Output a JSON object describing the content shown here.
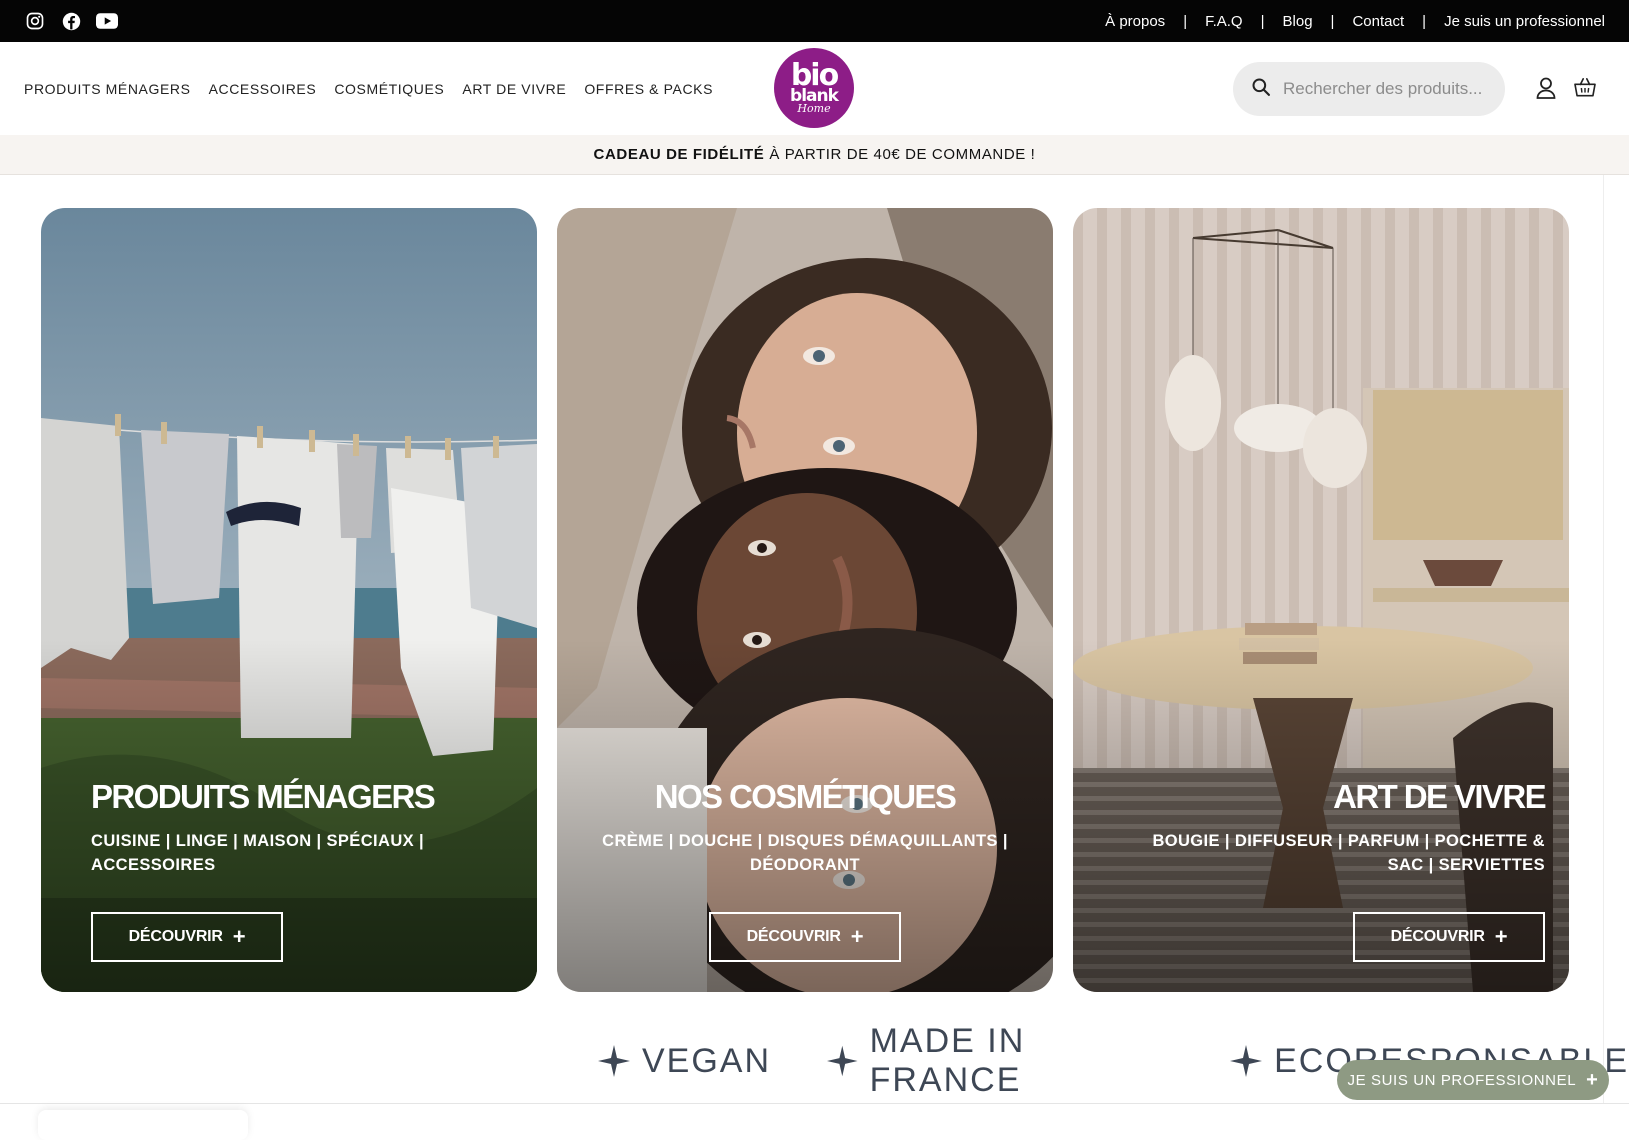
{
  "topbar": {
    "socials": [
      "instagram-icon",
      "facebook-icon",
      "youtube-icon"
    ],
    "links": [
      "À propos",
      "F.A.Q",
      "Blog",
      "Contact",
      "Je suis un professionnel"
    ],
    "separator": "|"
  },
  "header": {
    "nav": [
      "PRODUITS MÉNAGERS",
      "ACCESSOIRES",
      "COSMÉTIQUES",
      "ART DE VIVRE",
      "OFFRES & PACKS"
    ],
    "logo": {
      "line1": "bio",
      "line2": "blank",
      "line3": "Home",
      "color": "#8d1d87"
    },
    "search_placeholder": "Rechercher des produits...",
    "icons": [
      "search-icon",
      "account-icon",
      "cart-icon"
    ]
  },
  "promo": {
    "bold": "CADEAU DE FIDÉLITÉ",
    "rest": "À PARTIR DE 40€ DE COMMANDE !"
  },
  "cards": [
    {
      "title": "PRODUITS MÉNAGERS",
      "subtitle": "CUISINE | LINGE | MAISON | SPÉCIAUX | ACCESSOIRES",
      "button": "DÉCOUVRIR",
      "image": "clothesline"
    },
    {
      "title": "NOS COSMÉTIQUES",
      "subtitle": "CRÈME | DOUCHE | DISQUES DÉMAQUILLANTS | DÉODORANT",
      "button": "DÉCOUVRIR",
      "image": "portrait-faces"
    },
    {
      "title": "ART DE VIVRE",
      "subtitle": "BOUGIE | DIFFUSEUR | PARFUM | POCHETTE & SAC | SERVIETTES",
      "button": "DÉCOUVRIR",
      "image": "interior-room"
    }
  ],
  "values": [
    "VEGAN",
    "MADE IN FRANCE",
    "ECORESPONSABLE"
  ],
  "floating_button": "JE SUIS UN PROFESSIONNEL",
  "colors": {
    "topbar": "#050505",
    "brand": "#8d1d87",
    "promo_bg": "#f7f4f1",
    "pro_button": "#8e9a83",
    "values_text": "#3e4755"
  }
}
